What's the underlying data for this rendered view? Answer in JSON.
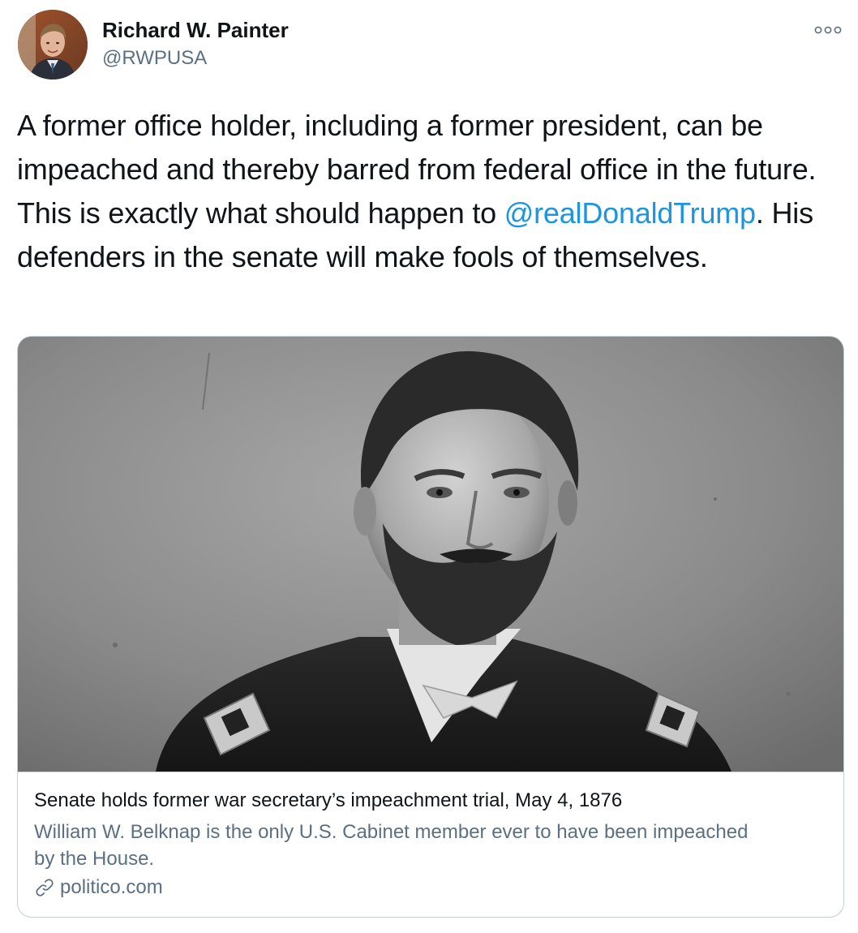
{
  "author": {
    "name": "Richard W. Painter",
    "handle": "@RWPUSA",
    "avatar_icon": "profile-photo"
  },
  "menu": {
    "icon": "more-options-icon"
  },
  "tweet": {
    "text_before": "A former office holder, including a former president, can be impeached and thereby barred from federal office in the future. This is exactly what should happen to ",
    "mention": "@realDonaldTrump",
    "text_after": ". His defenders in the senate will make fools of themselves."
  },
  "card": {
    "image_icon": "portrait-photo",
    "title": "Senate holds former war secretary’s impeachment trial, May 4, 1876",
    "description": "William W. Belknap is the only U.S. Cabinet member ever to have been impeached by the House.",
    "domain": "politico.com",
    "domain_icon": "link-icon"
  },
  "colors": {
    "link": "#1b95e0",
    "secondary_text": "#5b7083",
    "border": "#c4cfd6"
  }
}
